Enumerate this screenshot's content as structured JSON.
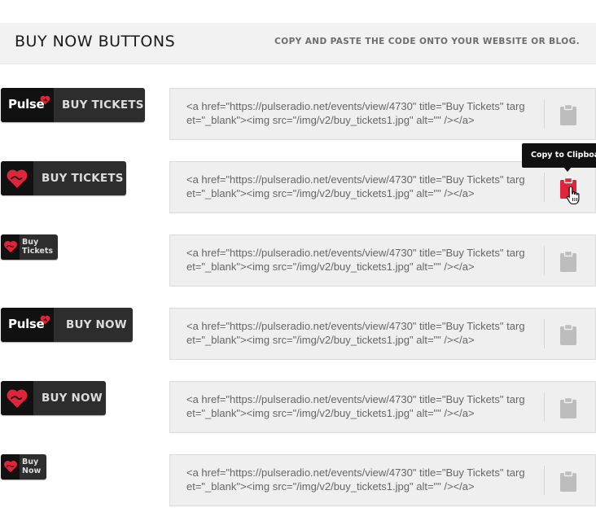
{
  "header": {
    "title": "BUY NOW BUTTONS",
    "subtitle": "COPY AND PASTE THE CODE ONTO YOUR WEBSITE OR BLOG."
  },
  "colors": {
    "brand_red": "#e0243a",
    "button_dark": "#2d2d2d",
    "logo_black": "#111111",
    "clipboard_inactive": "#bdbdbd"
  },
  "rows": [
    {
      "button_style": "pulse-logo-wide",
      "logo_text": "Pulse",
      "label": "BUY TICKETS",
      "code": "<a href=\"https://pulseradio.net/events/view/4730\" title=\"Buy Tickets\" target=\"_blank\"><img src=\"/img/v2/buy_tickets1.jpg\" alt=\"\" /></a>"
    },
    {
      "button_style": "heart-icon-wide",
      "label": "BUY TICKETS",
      "code": "<a href=\"https://pulseradio.net/events/view/4730\" title=\"Buy Tickets\" target=\"_blank\"><img src=\"/img/v2/buy_tickets1.jpg\" alt=\"\" /></a>"
    },
    {
      "button_style": "heart-icon-small",
      "label_line1": "Buy",
      "label_line2": "Tickets",
      "code": "<a href=\"https://pulseradio.net/events/view/4730\" title=\"Buy Tickets\" target=\"_blank\"><img src=\"/img/v2/buy_tickets1.jpg\" alt=\"\" /></a>"
    },
    {
      "button_style": "pulse-logo-wide",
      "logo_text": "Pulse",
      "label": "BUY NOW",
      "code": "<a href=\"https://pulseradio.net/events/view/4730\" title=\"Buy Tickets\" target=\"_blank\"><img src=\"/img/v2/buy_tickets1.jpg\" alt=\"\" /></a>"
    },
    {
      "button_style": "heart-icon-wide",
      "label": "BUY NOW",
      "code": "<a href=\"https://pulseradio.net/events/view/4730\" title=\"Buy Tickets\" target=\"_blank\"><img src=\"/img/v2/buy_tickets1.jpg\" alt=\"\" /></a>"
    },
    {
      "button_style": "heart-icon-small",
      "label_line1": "Buy",
      "label_line2": "Now",
      "code": "<a href=\"https://pulseradio.net/events/view/4730\" title=\"Buy Tickets\" target=\"_blank\"><img src=\"/img/v2/buy_tickets1.jpg\" alt=\"\" /></a>"
    }
  ],
  "tooltip": {
    "text": "Copy to Clipboard"
  },
  "icons": {
    "copy": "clipboard-icon",
    "pointer": "hand-pointer-icon",
    "brand": "pulse-heart-logo-icon"
  }
}
